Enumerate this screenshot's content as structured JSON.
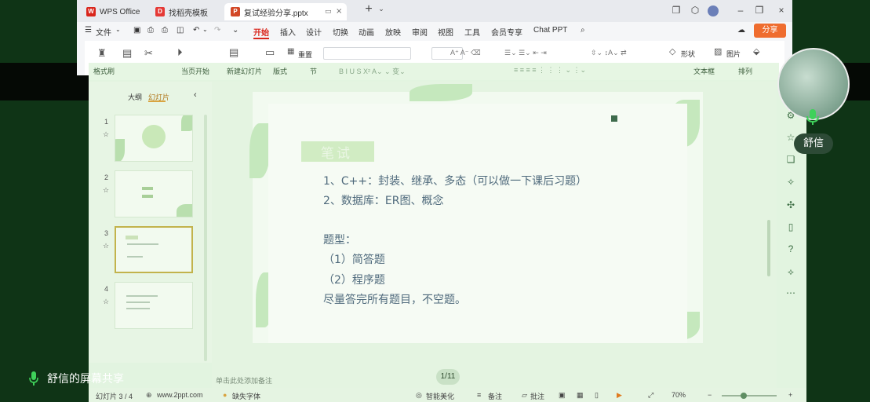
{
  "tabs": [
    {
      "label": "WPS Office",
      "icon": "wps-logo-icon"
    },
    {
      "label": "找稻壳模板",
      "icon": "docer-icon"
    },
    {
      "label": "复试经验分享.pptx",
      "icon": "ppt-file-icon"
    }
  ],
  "menu": [
    "文件",
    "开始",
    "插入",
    "设计",
    "切换",
    "动画",
    "放映",
    "审阅",
    "视图",
    "工具",
    "会员专享",
    "Chat PPT"
  ],
  "menu_active": "开始",
  "share_label": "分享",
  "ribbon": {
    "reset_label": "重置",
    "shape_label": "形状",
    "image_label": "图片",
    "format_brush": "格式刷",
    "start_from": "当页开始",
    "new_slide": "新建幻灯片",
    "layout": "版式",
    "section": "节",
    "textbox": "文本框",
    "arrange": "排列"
  },
  "panel": {
    "tab_outline": "大纲",
    "tab_slides": "幻灯片",
    "slides": [
      {
        "num": "1"
      },
      {
        "num": "2"
      },
      {
        "num": "3"
      },
      {
        "num": "4"
      }
    ]
  },
  "slide": {
    "title": "笔试",
    "lines": [
      "1、C++：封装、继承、多态（可以做一下课后习题）",
      "2、数据库：ER图、概念",
      "",
      "题型：",
      "（1）简答题",
      "（2）程序题",
      "尽量答完所有题目，不空题。"
    ]
  },
  "notes_placeholder": "单击此处添加备注",
  "page_indicator": "1/11",
  "status": {
    "slide_counter": "幻灯片 3 / 4",
    "site": "www.2ppt.com",
    "missing_font": "缺失字体",
    "smart_beautify": "智能美化",
    "notes": "备注",
    "comments": "批注",
    "zoom": "70%"
  },
  "overlay": {
    "user_name": "舒信",
    "screen_share": "舒信的屏幕共享"
  }
}
